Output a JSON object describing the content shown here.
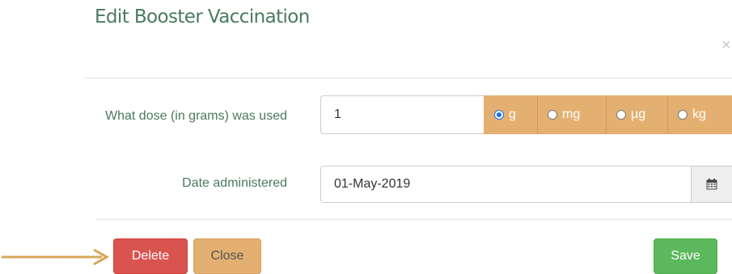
{
  "modal": {
    "title": "Edit Booster Vaccination",
    "close_glyph": "×"
  },
  "form": {
    "dose": {
      "label": "What dose (in grams) was used",
      "value": "1",
      "units": [
        {
          "label": "g",
          "checked": true
        },
        {
          "label": "mg",
          "checked": false
        },
        {
          "label": "µg",
          "checked": false
        },
        {
          "label": "kg",
          "checked": false
        }
      ]
    },
    "date": {
      "label": "Date administered",
      "value": "01-May-2019",
      "icon": "calendar-icon"
    }
  },
  "footer": {
    "delete_label": "Delete",
    "close_label": "Close",
    "save_label": "Save"
  },
  "annotation": {
    "icon": "arrow-right-icon",
    "color": "#d8a857"
  },
  "colors": {
    "title": "#4a7a5f",
    "unit_addon": "#e4b071",
    "delete": "#d9534f",
    "save": "#5cb85c"
  }
}
